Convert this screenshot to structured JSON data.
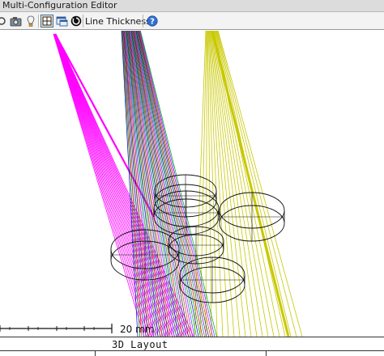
{
  "window": {
    "title": "Multi-Configuration Editor"
  },
  "toolbar": {
    "icons": [
      "camera-icon",
      "bulb-icon",
      "layout-grid-icon",
      "window-icon",
      "refresh-icon"
    ],
    "line_thickness_label": "Line Thickness",
    "help_icon": "help-icon"
  },
  "plot": {
    "scale_label": "20 mm",
    "caption": "3D Layout"
  },
  "colors": {
    "magenta": "#ff00ff",
    "yellow": "#c8c800",
    "toolbar_active": "#fbe3b0",
    "help_blue": "#2f6fd0"
  }
}
